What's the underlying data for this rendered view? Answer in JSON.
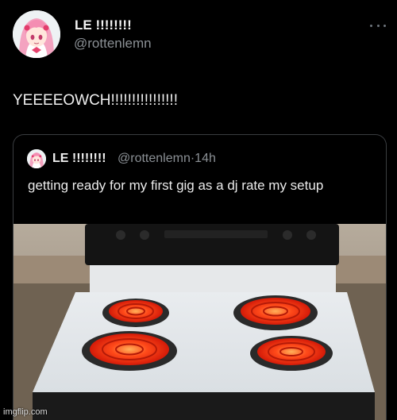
{
  "tweet": {
    "display_name": "LE !!!!!!!!",
    "handle": "@rottenlemn",
    "text": "YEEEEOWCH!!!!!!!!!!!!!!!!",
    "more_icon": "more-horizontal-icon"
  },
  "quoted_tweet": {
    "display_name": "LE !!!!!!!!",
    "handle": "@rottenlemn",
    "separator": "·",
    "time": "14h",
    "text": "getting ready for my first gig as a dj rate my setup",
    "media_description": "electric stove with red-hot coils"
  },
  "watermark": "imgflip.com",
  "colors": {
    "background": "#000000",
    "text": "#e7e9ea",
    "secondary_text": "#8b9095",
    "border": "#3a3d40",
    "coil_hot": "#ff3a12"
  }
}
